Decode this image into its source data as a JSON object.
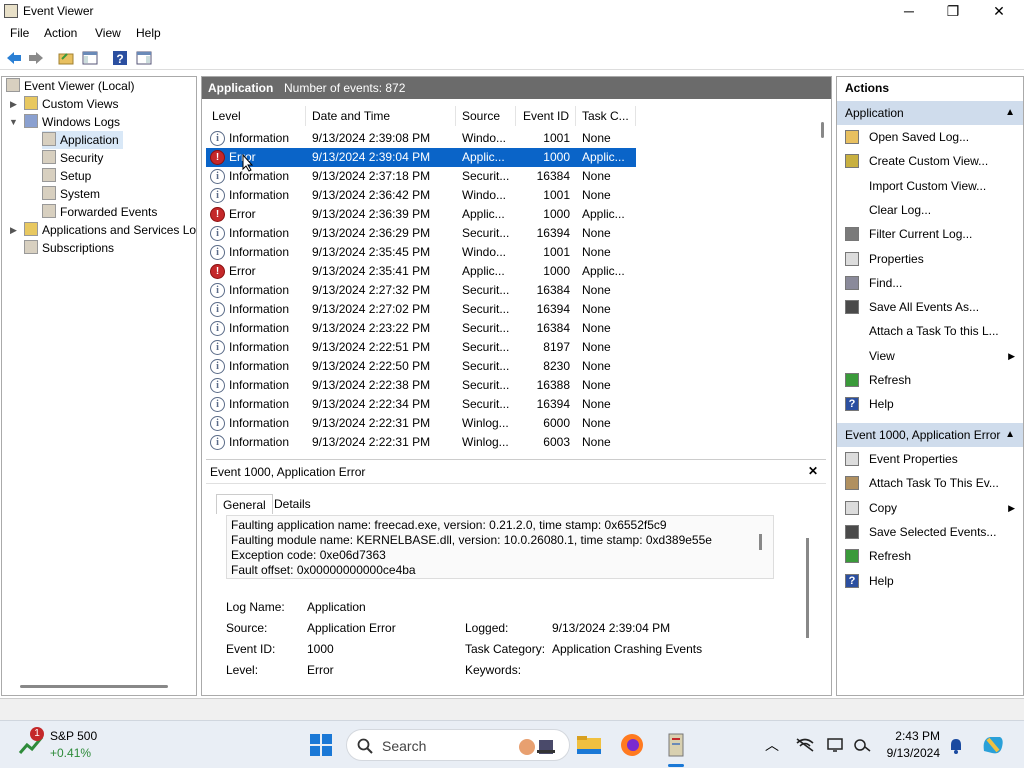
{
  "window": {
    "title": "Event Viewer",
    "minimize": "─",
    "maximize": "❐",
    "close": "✕"
  },
  "menu": {
    "file": "File",
    "action": "Action",
    "view": "View",
    "help": "Help"
  },
  "tree": {
    "root": "Event Viewer (Local)",
    "custom_views": "Custom Views",
    "windows_logs": "Windows Logs",
    "application": "Application",
    "security": "Security",
    "setup": "Setup",
    "system": "System",
    "forwarded_events": "Forwarded Events",
    "apps_services": "Applications and Services Lo",
    "subscriptions": "Subscriptions"
  },
  "log": {
    "name": "Application",
    "count_text": "Number of events: 872",
    "columns": {
      "level": "Level",
      "datetime": "Date and Time",
      "source": "Source",
      "event_id": "Event ID",
      "task": "Task C..."
    },
    "rows": [
      {
        "level": "Information",
        "datetime": "9/13/2024 2:39:08 PM",
        "source": "Windo...",
        "event_id": "1001",
        "task": "None"
      },
      {
        "level": "Error",
        "datetime": "9/13/2024 2:39:04 PM",
        "source": "Applic...",
        "event_id": "1000",
        "task": "Applic..."
      },
      {
        "level": "Information",
        "datetime": "9/13/2024 2:37:18 PM",
        "source": "Securit...",
        "event_id": "16384",
        "task": "None"
      },
      {
        "level": "Information",
        "datetime": "9/13/2024 2:36:42 PM",
        "source": "Windo...",
        "event_id": "1001",
        "task": "None"
      },
      {
        "level": "Error",
        "datetime": "9/13/2024 2:36:39 PM",
        "source": "Applic...",
        "event_id": "1000",
        "task": "Applic..."
      },
      {
        "level": "Information",
        "datetime": "9/13/2024 2:36:29 PM",
        "source": "Securit...",
        "event_id": "16394",
        "task": "None"
      },
      {
        "level": "Information",
        "datetime": "9/13/2024 2:35:45 PM",
        "source": "Windo...",
        "event_id": "1001",
        "task": "None"
      },
      {
        "level": "Error",
        "datetime": "9/13/2024 2:35:41 PM",
        "source": "Applic...",
        "event_id": "1000",
        "task": "Applic..."
      },
      {
        "level": "Information",
        "datetime": "9/13/2024 2:27:32 PM",
        "source": "Securit...",
        "event_id": "16384",
        "task": "None"
      },
      {
        "level": "Information",
        "datetime": "9/13/2024 2:27:02 PM",
        "source": "Securit...",
        "event_id": "16394",
        "task": "None"
      },
      {
        "level": "Information",
        "datetime": "9/13/2024 2:23:22 PM",
        "source": "Securit...",
        "event_id": "16384",
        "task": "None"
      },
      {
        "level": "Information",
        "datetime": "9/13/2024 2:22:51 PM",
        "source": "Securit...",
        "event_id": "8197",
        "task": "None"
      },
      {
        "level": "Information",
        "datetime": "9/13/2024 2:22:50 PM",
        "source": "Securit...",
        "event_id": "8230",
        "task": "None"
      },
      {
        "level": "Information",
        "datetime": "9/13/2024 2:22:38 PM",
        "source": "Securit...",
        "event_id": "16388",
        "task": "None"
      },
      {
        "level": "Information",
        "datetime": "9/13/2024 2:22:34 PM",
        "source": "Securit...",
        "event_id": "16394",
        "task": "None"
      },
      {
        "level": "Information",
        "datetime": "9/13/2024 2:22:31 PM",
        "source": "Winlog...",
        "event_id": "6000",
        "task": "None"
      },
      {
        "level": "Information",
        "datetime": "9/13/2024 2:22:31 PM",
        "source": "Winlog...",
        "event_id": "6003",
        "task": "None"
      }
    ],
    "selected_level_text": "Error"
  },
  "detail": {
    "title": "Event 1000, Application Error",
    "close": "✕",
    "tab_general": "General",
    "tab_details": "Details",
    "desc_lines": [
      "Faulting application name: freecad.exe, version: 0.21.2.0, time stamp: 0x6552f5c9",
      "Faulting module name: KERNELBASE.dll, version: 10.0.26080.1, time stamp: 0xd389e55e",
      "Exception code: 0xe06d7363",
      "Fault offset: 0x00000000000ce4ba"
    ],
    "props": {
      "log_name_label": "Log Name:",
      "log_name": "Application",
      "source_label": "Source:",
      "source": "Application Error",
      "logged_label": "Logged:",
      "logged": "9/13/2024 2:39:04 PM",
      "event_id_label": "Event ID:",
      "event_id": "1000",
      "task_cat_label": "Task Category:",
      "task_cat": "Application Crashing Events",
      "level_label": "Level:",
      "level": "Error",
      "keywords_label": "Keywords:"
    }
  },
  "actions": {
    "header": "Actions",
    "sec1": "Application",
    "items1": [
      "Open Saved Log...",
      "Create Custom View...",
      "Import Custom View...",
      "Clear Log...",
      "Filter Current Log...",
      "Properties",
      "Find...",
      "Save All Events As...",
      "Attach a Task To this L...",
      "View",
      "Refresh",
      "Help"
    ],
    "sec2": "Event 1000, Application Error",
    "items2": [
      "Event Properties",
      "Attach Task To This Ev...",
      "Copy",
      "Save Selected Events...",
      "Refresh",
      "Help"
    ]
  },
  "taskbar": {
    "stock_name": "S&P 500",
    "stock_change": "+0.41%",
    "stock_badge": "1",
    "search_placeholder": "Search",
    "time": "2:43 PM",
    "date": "9/13/2024"
  }
}
